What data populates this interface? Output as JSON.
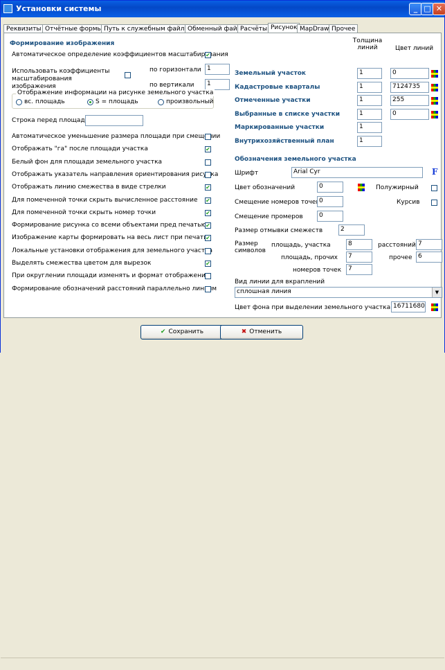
{
  "window": {
    "title": "Установки системы",
    "controls": [
      "minimize-icon",
      "maximize-icon",
      "close-icon"
    ]
  },
  "tabs": [
    {
      "label": "Реквизиты",
      "active": false
    },
    {
      "label": "Отчётные формы",
      "active": false
    },
    {
      "label": "Путь к служебным файлам",
      "active": false
    },
    {
      "label": "Обменный файл",
      "active": false
    },
    {
      "label": "Расчёты",
      "active": false
    },
    {
      "label": "Рисунок",
      "active": true
    },
    {
      "label": "MapDraw",
      "active": false
    },
    {
      "label": "Прочее",
      "active": false
    }
  ],
  "left": {
    "section_title": "Формирование изображения",
    "auto_scale_label": "Автоматическое определение коэффициентов масштабирования",
    "auto_scale_checked": true,
    "use_coeff_label": "Использовать коэффициенты масштабирования изображения",
    "use_coeff_checked": false,
    "horiz_label": "по горизонтали",
    "horiz_value": "1",
    "vert_label": "по вертикали",
    "vert_value": "1",
    "display_group_label": "Отображение информации на рисунке земельного участка",
    "radio_all": "вс. площадь",
    "radio_s": "S = площадь",
    "radio_any": "произвольный",
    "prefix_label": "Строка перед площадью",
    "prefix_value": "",
    "options": [
      {
        "label": "Автоматическое уменьшение размера площади при смещении",
        "checked": false
      },
      {
        "label": "Отображать \"га\" после площади участка",
        "checked": true
      },
      {
        "label": "Белый фон для площади земельного участка",
        "checked": false
      },
      {
        "label": "Отображать указатель направления ориентирования рисунка",
        "checked": false
      },
      {
        "label": "Отображать линию смежества в виде стрелки",
        "checked": true
      },
      {
        "label": "Для помеченной точки скрыть вычисленное расстояние",
        "checked": true
      },
      {
        "label": "Для помеченной точки скрыть номер точки",
        "checked": true
      },
      {
        "label": "Формирование рисунка со всеми объектами пред печатью",
        "checked": true
      },
      {
        "label": "Изображение карты формировать на весь лист при печати",
        "checked": true
      },
      {
        "label": "Локальные установки отображения для земельного участка",
        "checked": false
      },
      {
        "label": "Выделять смежества цветом для вырезок",
        "checked": true
      },
      {
        "label": "При округлении площади изменять и формат отображения",
        "checked": false
      },
      {
        "label": "Формирование обозначений расстояний параллельно линиям",
        "checked": false
      }
    ]
  },
  "right": {
    "col_thickness": "Толщина линий",
    "col_color": "Цвет линий",
    "layers": [
      {
        "label": "Земельный участок",
        "thickness": "1",
        "color": "0",
        "has_color": true
      },
      {
        "label": "Кадастровые кварталы",
        "thickness": "1",
        "color": "7124735",
        "has_color": true
      },
      {
        "label": "Отмеченные участки",
        "thickness": "1",
        "color": "255",
        "has_color": true
      },
      {
        "label": "Выбранные в списке участки",
        "thickness": "1",
        "color": "0",
        "has_color": true
      },
      {
        "label": "Маркированные участки",
        "thickness": "1",
        "color": "",
        "has_color": false
      },
      {
        "label": "Внутрихозяйственный план",
        "thickness": "1",
        "color": "",
        "has_color": false
      }
    ],
    "notation_title": "Обозначения земельного участка",
    "font_label": "Шрифт",
    "font_value": "Arial Cyr",
    "font_btn": "F",
    "color_label": "Цвет обозначений",
    "color_value": "0",
    "bold_label": "Полужирный",
    "bold_checked": false,
    "italic_label": "Курсив",
    "italic_checked": false,
    "shift_points_label": "Смещение номеров точек",
    "shift_points_value": "0",
    "shift_measures_label": "Смещение промеров",
    "shift_measures_value": "0",
    "adj_size_label": "Размер отмывки смежеств",
    "adj_size_value": "2",
    "size_label": "Размер символов",
    "area_parcel_label": "площадь, участка",
    "area_parcel_value": "8",
    "area_other_label": "площадь, прочих",
    "area_other_value": "7",
    "points_label": "номеров точек",
    "points_value": "7",
    "distances_label": "расстояний",
    "distances_value": "7",
    "other_label": "прочее",
    "other_value": "6",
    "line_type_label": "Вид линии для вкраплений",
    "line_type_value": "сплошная линия",
    "bg_color_label": "Цвет фона при выделении земельного участка",
    "bg_color_value": "16711680"
  },
  "footer": {
    "save_label": "Сохранить",
    "cancel_label": "Отменить"
  }
}
